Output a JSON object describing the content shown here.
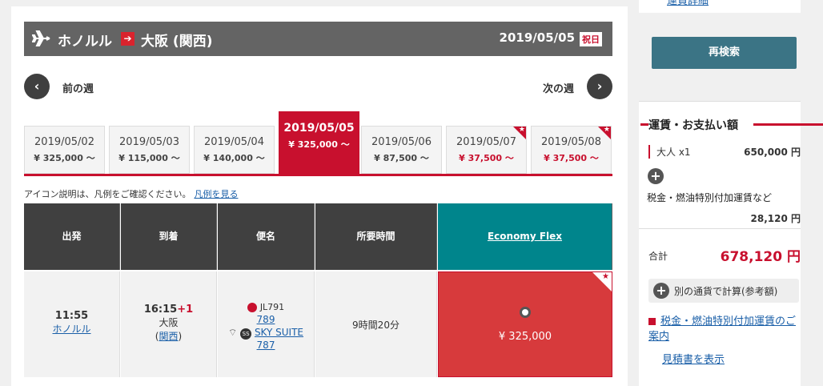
{
  "route": {
    "from": "ホノルル",
    "to": "大阪 (関西)",
    "date": "2019/05/05",
    "holiday_badge": "祝日"
  },
  "week_nav": {
    "prev_label": "前の週",
    "next_label": "次の週"
  },
  "date_tabs": [
    {
      "date": "2019/05/02",
      "price": "¥ 325,000 〜"
    },
    {
      "date": "2019/05/03",
      "price": "¥ 115,000 〜"
    },
    {
      "date": "2019/05/04",
      "price": "¥ 140,000 〜"
    },
    {
      "date": "2019/05/05",
      "price": "¥ 325,000 〜"
    },
    {
      "date": "2019/05/06",
      "price": "¥ 87,500 〜"
    },
    {
      "date": "2019/05/07",
      "price": "¥ 37,500 〜"
    },
    {
      "date": "2019/05/08",
      "price": "¥ 37,500 〜"
    }
  ],
  "legend": {
    "text": "アイコン説明は、凡例をご確認ください。",
    "link": "凡例を見る"
  },
  "table": {
    "headers": {
      "depart": "出発",
      "arrive": "到着",
      "flight": "便名",
      "duration": "所要時間",
      "fare": "Economy Flex"
    },
    "row": {
      "depart_time": "11:55",
      "depart_city": "ホノルル",
      "arrive_time": "16:15",
      "arrive_plus": "+1",
      "arrive_city": "大阪",
      "arrive_airport": "関西",
      "flight_no": "JL791",
      "aircraft": "789",
      "seat": "SKY SUITE 787",
      "ss_badge": "SS",
      "duration": "9時間20分",
      "fare_price": "¥ 325,000"
    }
  },
  "side": {
    "top_link": "運賃詳細",
    "research": "再検索",
    "summary_title": "運賃・お支払い額",
    "adult": "大人 x1",
    "adult_amount": "650,000 円",
    "tax_label": "税金・燃油特別付加運賃など",
    "tax_amount": "28,120 円",
    "total_label": "合計",
    "total_amount": "678,120 円",
    "currency": "別の通貨で計算(参考額)",
    "tax_info": "税金・燃油特別付加運賃のご案内",
    "quote": "見積書を表示"
  }
}
